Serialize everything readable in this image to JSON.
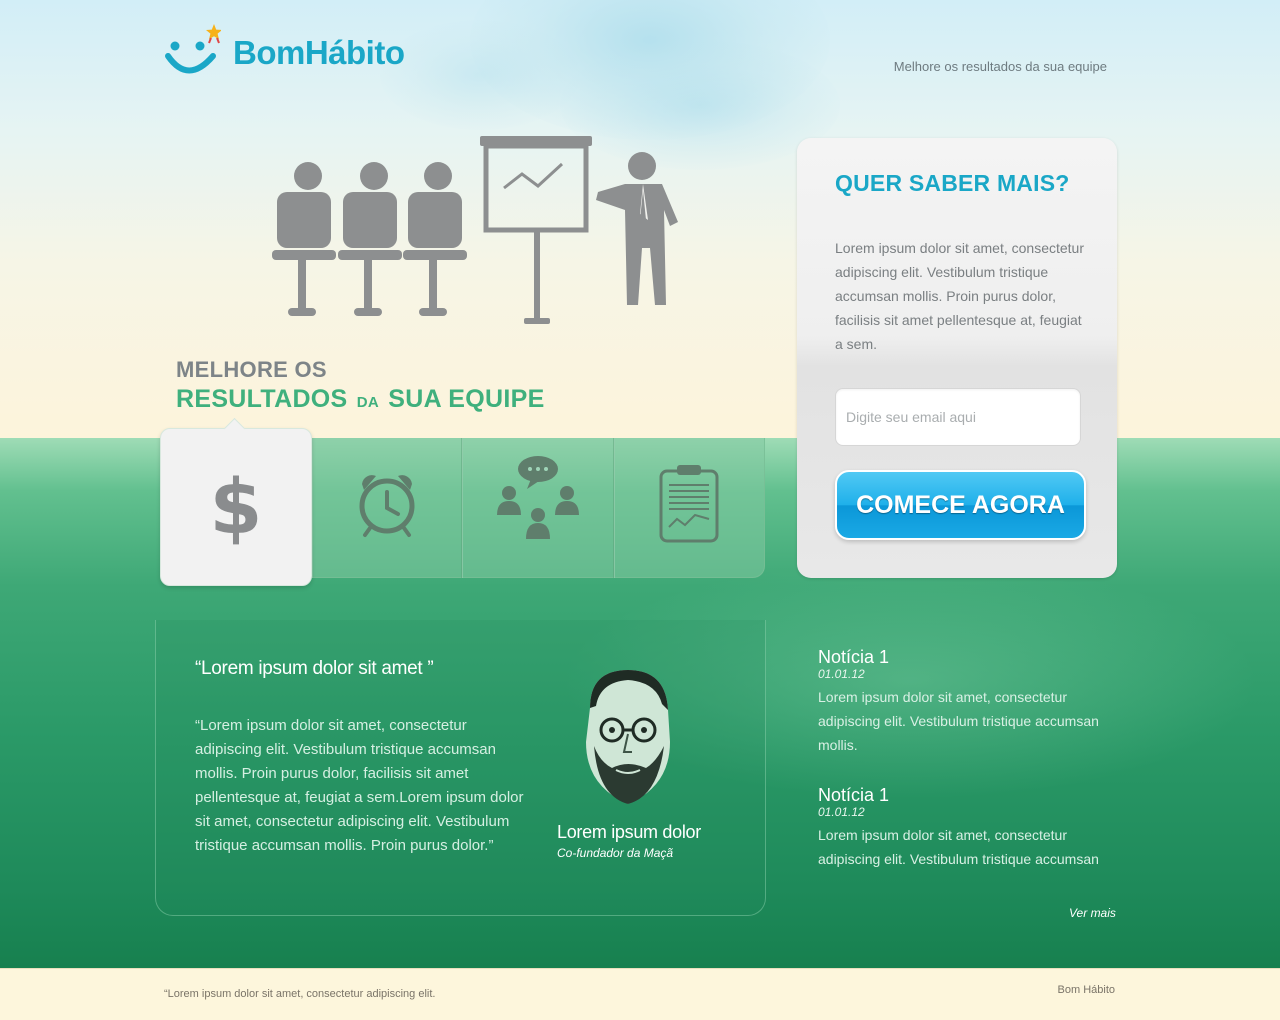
{
  "header": {
    "brand": "BomHábito",
    "tagline": "Melhore os resultados da sua equipe"
  },
  "hero": {
    "line1": "MELHORE OS",
    "line2_a": "RESULTADOS",
    "line2_small": "DA",
    "line2_b": "SUA EQUIPE"
  },
  "tabs": [
    {
      "icon": "dollar-icon",
      "active": true
    },
    {
      "icon": "alarm-clock-icon",
      "active": false
    },
    {
      "icon": "team-chat-icon",
      "active": false
    },
    {
      "icon": "clipboard-chart-icon",
      "active": false
    }
  ],
  "signup": {
    "title": "QUER SABER MAIS?",
    "text": "Lorem ipsum dolor sit amet, consectetur adipiscing elit. Vestibulum tristique accumsan mollis. Proin purus dolor, facilisis sit amet pellentesque at, feugiat a sem.",
    "email_placeholder": "Digite seu email aqui",
    "button_label": "COMECE AGORA"
  },
  "testimonial": {
    "title": "“Lorem ipsum dolor sit amet ”",
    "body": "“Lorem ipsum dolor sit amet, consectetur adipiscing elit. Vestibulum tristique accumsan mollis. Proin purus dolor, facilisis sit amet pellentesque at, feugiat a sem.Lorem ipsum dolor sit amet, consectetur adipiscing elit. Vestibulum tristique accumsan mollis. Proin purus dolor.”",
    "name": "Lorem ipsum dolor",
    "role": "Co-fundador da Maçã"
  },
  "news": [
    {
      "title": "Notícia 1",
      "date": "01.01.12",
      "body": "Lorem ipsum dolor sit amet, consectetur adipiscing elit. Vestibulum tristique accumsan mollis."
    },
    {
      "title": "Notícia 1",
      "date": "01.01.12",
      "body": "Lorem ipsum dolor sit amet, consectetur adipiscing elit. Vestibulum tristique accumsan"
    }
  ],
  "see_more": "Ver mais",
  "footer": {
    "left": "“Lorem ipsum dolor sit amet, consectetur adipiscing elit.",
    "right": "Bom Hábito"
  },
  "colors": {
    "brand_blue": "#1aa7c7",
    "accent_green": "#3fb07d",
    "cta_blue": "#1fb0ea",
    "grass_green": "#2b9a68"
  }
}
